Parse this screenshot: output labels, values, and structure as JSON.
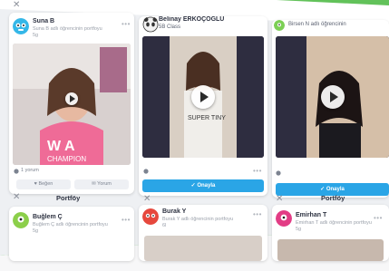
{
  "colors": {
    "accent_green": "#62c25a",
    "button_blue": "#2aa5e6"
  },
  "cards": [
    {
      "name": "Suna B",
      "subtitle_line1": "Suna B adlı öğrencinin portfoyu",
      "subtitle_line2": "5g",
      "likes": "1 yorum",
      "like_label": "Beğen",
      "comment_label": "Yorum"
    },
    {
      "name": "Belinay ERKOÇOĞLU",
      "subtitle": "5B Class",
      "approve_label": "Onayla"
    },
    {
      "name": "Birsen N adlı öğrencinin",
      "approve_label": "Onayla"
    }
  ],
  "second_row": {
    "title": "Portföy",
    "items": [
      {
        "name": "Buğlem Ç",
        "line1": "Buğlem Ç adlı öğrencinin portfoyu",
        "line2": "5g"
      },
      {
        "name": "Burak Y",
        "line1": "Burak Y adlı öğrencinin portfoyu",
        "line2": "6l"
      },
      {
        "name": "Emirhan T",
        "line1": "Emirhan T adlı öğrencinin portfoyu",
        "line2": "5g"
      }
    ]
  },
  "shirt_text": "SUPER TINY",
  "hoodie_text": "W A CHAMPION"
}
